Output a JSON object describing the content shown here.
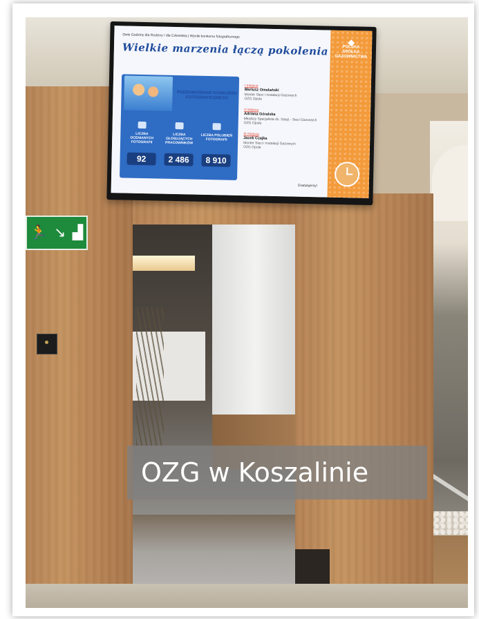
{
  "caption": "OZG w Koszalinie",
  "tv_screen": {
    "breadcrumb": "Dwie Godziny dla Rodziny / dla Człowieka | Wyniki konkursu fotograficznego",
    "title": "Wielkie marzenia łączą pokolenia",
    "summary_heading": "PODSUMOWANIE KONKURSU FOTOGRAFICZNEGO",
    "brand": "POLSKA SPÓŁKA GAZOWNICTWA",
    "stats": [
      {
        "label": "LICZBA OCENIANYCH FOTOGRAFII",
        "value": "92"
      },
      {
        "label": "LICZBA GŁOSUJĄCYCH PRACOWNIKÓW",
        "value": "2 486"
      },
      {
        "label": "LICZBA POLUBIEŃ FOTOGRAFII",
        "value": "8 910"
      }
    ],
    "winners": [
      {
        "place": "I miejsce",
        "name": "Mariusz Omelański",
        "role": "Monter Sieci i Instalacji Gazowych",
        "unit": "OZG Opole"
      },
      {
        "place": "II miejsce",
        "name": "Adriana Góralska",
        "role": "Młodszy Specjalista ds. Stacji - Sieci Gazowych",
        "unit": "OZG Opole"
      },
      {
        "place": "III miejsce",
        "name": "Jacek Czajka",
        "role": "Monter Sieci i Instalacji Gazowych",
        "unit": "OZG Opole"
      }
    ],
    "footer": "Gratulujemy!"
  },
  "exit_sign": {
    "glyphs": [
      "🏃",
      "↘",
      "▟"
    ]
  },
  "colors": {
    "accent_orange": "#f39a3a",
    "screen_blue": "#2f6cc4",
    "exit_green": "#1e8a3c"
  }
}
